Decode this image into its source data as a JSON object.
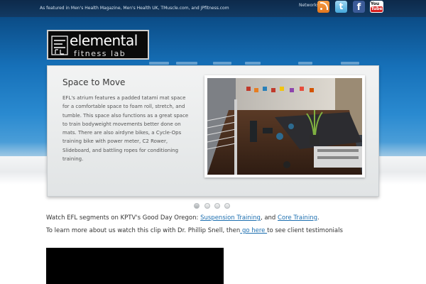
{
  "header": {
    "featured_text": "As featured in Men's Health Magazine, Men's Health UK, TMuscle.com, and JPfitness.com",
    "networks_label": "Networks",
    "social_icons": [
      "rss-icon",
      "twitter-icon",
      "facebook-icon",
      "youtube-icon"
    ],
    "twitter_glyph": "t",
    "facebook_glyph": "f",
    "youtube_you": "You",
    "youtube_tube": "Tube"
  },
  "logo": {
    "name": "elemental",
    "sub": "fitness lab"
  },
  "slider": {
    "title": "Space to Move",
    "description": "EFL's atrium features a padded tatami mat space for a comfortable space to foam roll, stretch, and tumble. This space also functions as a great space to train bodyweight movements better done on mats. There are also airdyne bikes, a Cycle-Ops training bike with power meter, C2 Rower, Slideboard, and battling ropes for conditioning training.",
    "slide_count": 4,
    "active_slide": 1
  },
  "content": {
    "line1_prefix": "Watch EFL segments on KPTV's Good Day Oregon: ",
    "line1_link1": "Suspension Training",
    "line1_mid": ", and ",
    "line1_link2": "Core Training",
    "line1_suffix": ".",
    "line2_prefix": "To learn more about us watch this clip with Dr. Phillip Snell, then",
    "line2_link": " go here ",
    "line2_suffix": "to see client testimonials"
  },
  "colors": {
    "topbar": "#0d2a4a",
    "hero_blue": "#1670b8",
    "link": "#1d6fb0"
  }
}
